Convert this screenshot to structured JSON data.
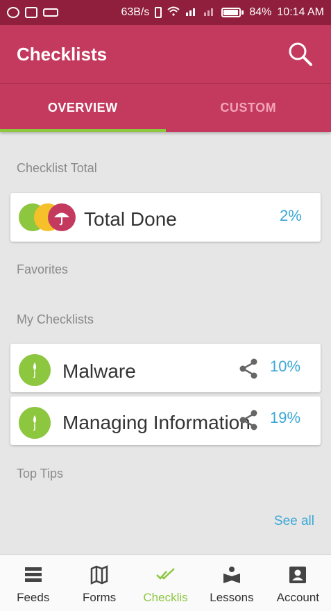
{
  "status_bar": {
    "speed": "63B/s",
    "battery_pct": "84%",
    "battery_level": 0.84,
    "time": "10:14 AM",
    "icons": [
      "whatsapp-icon",
      "image-icon",
      "laptop-icon",
      "vibrate-icon",
      "wifi-icon",
      "signal-icon",
      "signal-icon",
      "battery-icon"
    ]
  },
  "appbar": {
    "title": "Checklists",
    "icon": "search-icon"
  },
  "tabs": [
    {
      "label": "OVERVIEW",
      "active": true
    },
    {
      "label": "CUSTOM",
      "active": false
    }
  ],
  "sections": {
    "checklist_total": "Checklist Total",
    "favorites": "Favorites",
    "my_checklists": "My Checklists",
    "top_tips": "Top Tips"
  },
  "total_card": {
    "label": "Total Done",
    "percent": "2%",
    "icon": "umbrella-stack-icon"
  },
  "checklists": [
    {
      "name": "Malware",
      "percent": "10%",
      "icon": "umbrella-icon"
    },
    {
      "name": "Managing Information",
      "percent": "19%",
      "icon": "umbrella-icon"
    }
  ],
  "see_all": "See all",
  "bottom_nav": [
    {
      "label": "Feeds",
      "icon": "feeds-icon",
      "active": false
    },
    {
      "label": "Forms",
      "icon": "map-icon",
      "active": false
    },
    {
      "label": "Checklis",
      "icon": "double-check-icon",
      "active": true
    },
    {
      "label": "Lessons",
      "icon": "reader-icon",
      "active": false
    },
    {
      "label": "Account",
      "icon": "account-icon",
      "active": false
    }
  ],
  "colors": {
    "primary": "#c43a5e",
    "status_bar": "#8f1f3c",
    "accent_green": "#8dc63f",
    "link_blue": "#3aa7d6",
    "umbrella_yellow": "#f5c02a"
  }
}
